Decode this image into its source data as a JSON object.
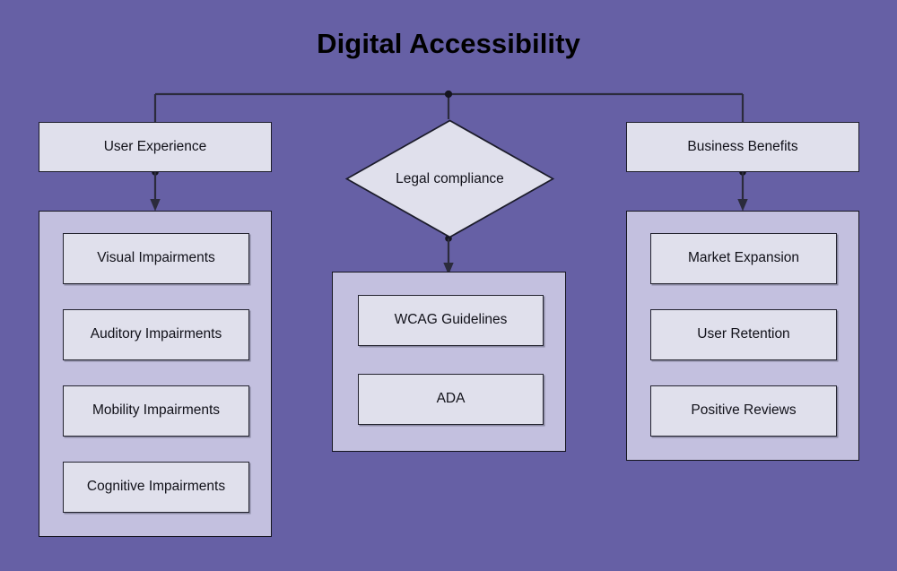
{
  "title": "Digital Accessibility",
  "theme": {
    "background": "#6660a5",
    "node_fill": "#e0e0ec",
    "container_fill": "#c3c0df",
    "border": "#1c1c2b",
    "connector": "#2b2b3c",
    "text": "#111119"
  },
  "branches": {
    "left": {
      "header": "User Experience",
      "items": [
        "Visual Impairments",
        "Auditory Impairments",
        "Mobility Impairments",
        "Cognitive Impairments"
      ]
    },
    "center": {
      "header": "Legal compliance",
      "header_shape": "diamond",
      "items": [
        "WCAG Guidelines",
        "ADA"
      ]
    },
    "right": {
      "header": "Business Benefits",
      "items": [
        "Market Expansion",
        "User Retention",
        "Positive Reviews"
      ]
    }
  }
}
